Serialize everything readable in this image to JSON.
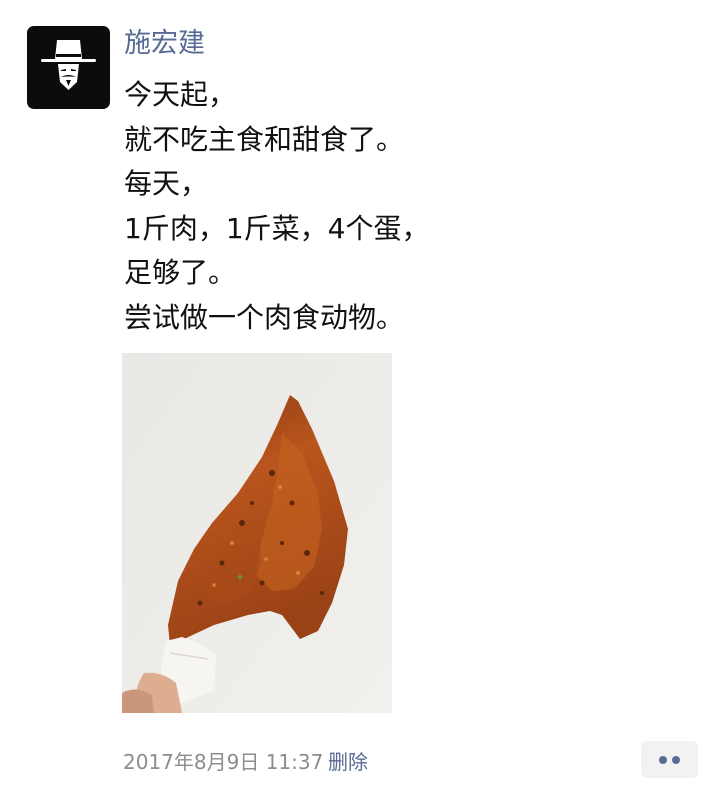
{
  "post": {
    "author": "施宏建",
    "lines": [
      "今天起，",
      "就不吃主食和甜食了。",
      "每天，",
      "1斤肉，1斤菜，4个蛋，",
      "足够了。",
      "尝试做一个肉食动物。"
    ],
    "photo_icon": "fried-chicken-wing-photo",
    "timestamp": "2017年8月9日 11:37",
    "delete_label": "删除"
  },
  "avatar": {
    "icon": "masked-man-hat-icon",
    "colors": {
      "background": "#0c0c0c",
      "figure": "#ffffff"
    }
  },
  "more_button": {
    "icon": "two-dots-icon"
  },
  "colors": {
    "link": "#576b95",
    "text": "#111111",
    "meta": "#8c8c8c",
    "button_bg": "#f2f2f2"
  }
}
